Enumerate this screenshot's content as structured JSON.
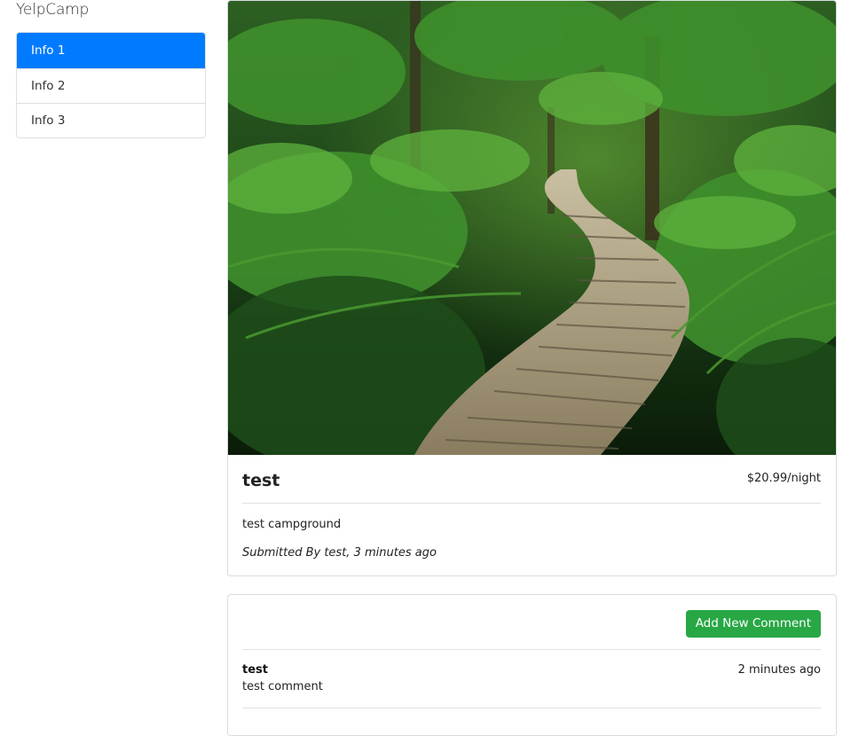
{
  "brand": "YelpCamp",
  "sidebar": {
    "items": [
      {
        "label": "Info 1",
        "active": true
      },
      {
        "label": "Info 2",
        "active": false
      },
      {
        "label": "Info 3",
        "active": false
      }
    ]
  },
  "campground": {
    "name": "test",
    "price": "$20.99/night",
    "description": "test campground",
    "submitted": "Submitted By test, 3 minutes ago"
  },
  "comments": {
    "add_button": "Add New Comment",
    "items": [
      {
        "author": "test",
        "time": "2 minutes ago",
        "text": "test comment"
      }
    ]
  },
  "colors": {
    "primary": "#007bff",
    "success": "#28a745",
    "border": "#dee2e6"
  }
}
